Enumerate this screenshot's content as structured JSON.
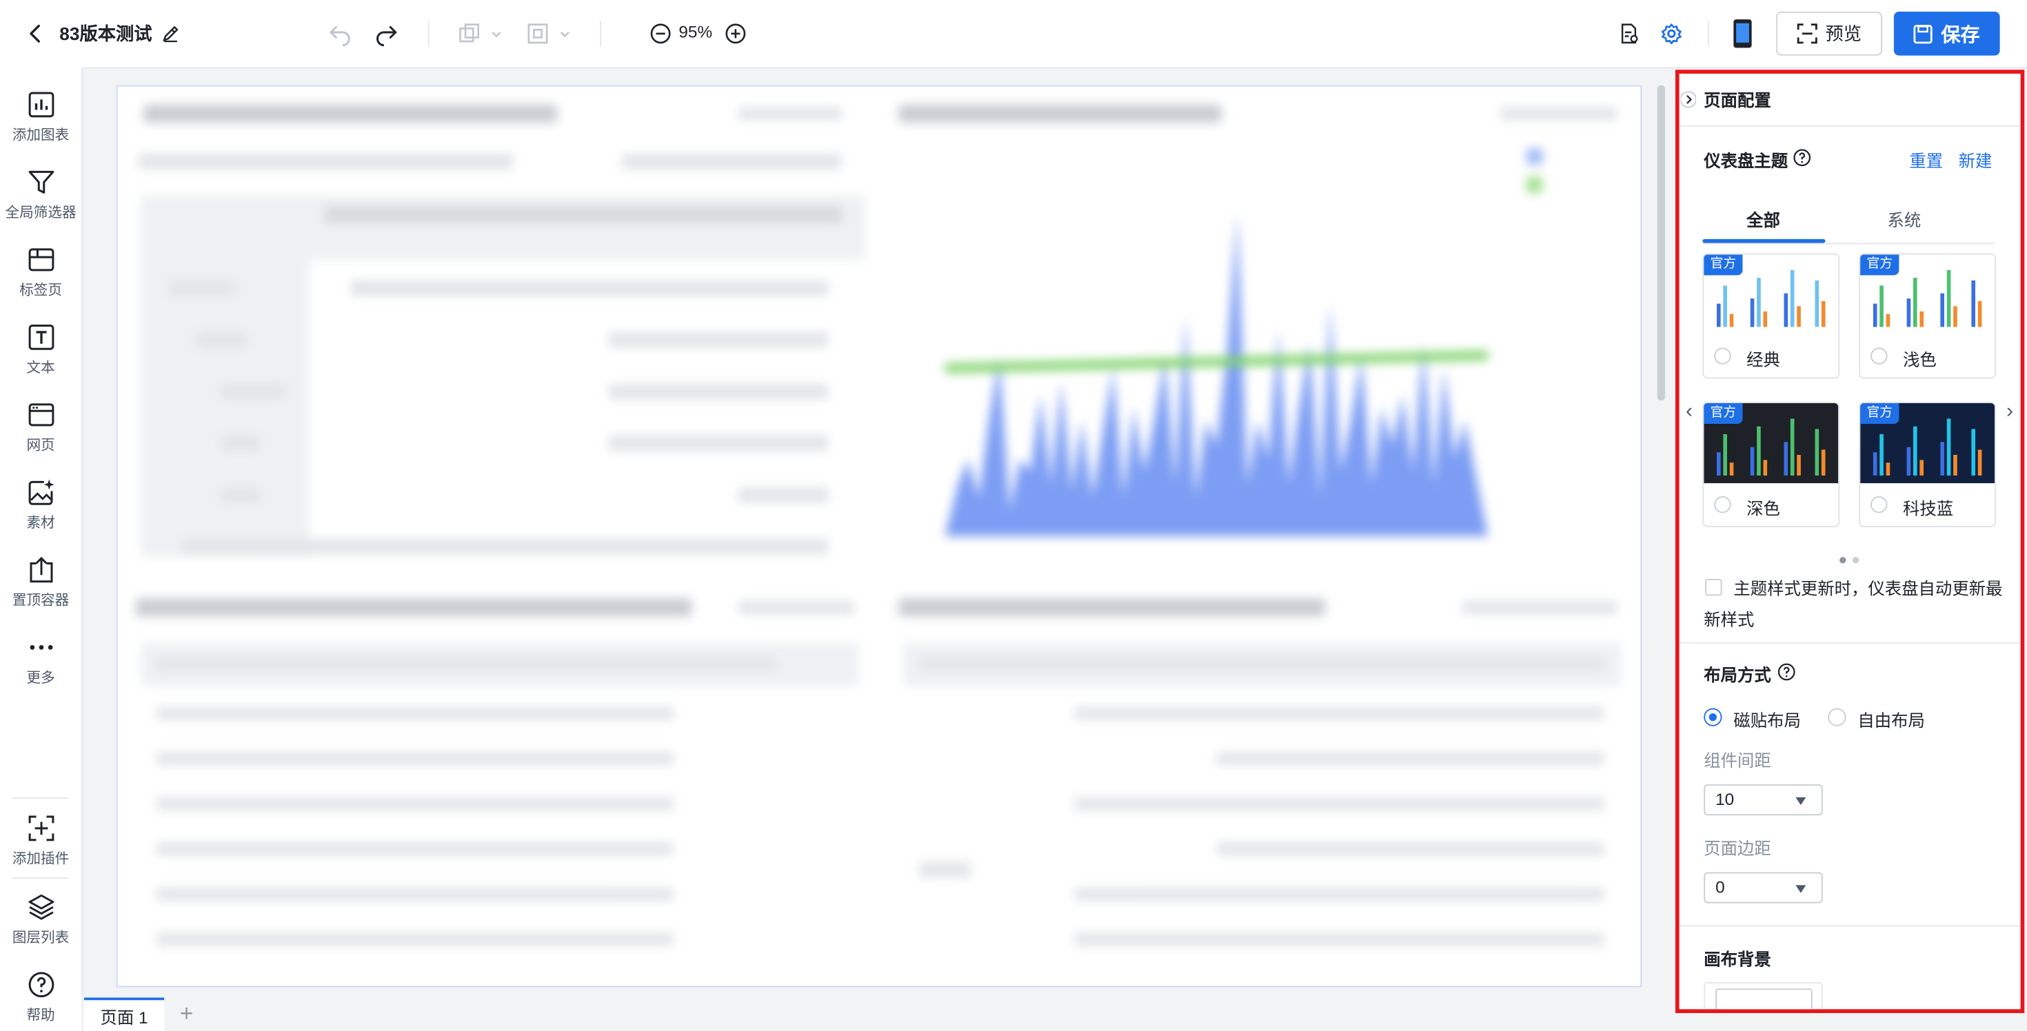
{
  "header": {
    "title": "83版本测试",
    "zoom": "95%",
    "preview_label": "预览",
    "save_label": "保存"
  },
  "leftbar": {
    "items": [
      {
        "label": "添加图表",
        "icon": "bar-chart-icon"
      },
      {
        "label": "全局筛选器",
        "icon": "filter-icon"
      },
      {
        "label": "标签页",
        "icon": "tab-page-icon"
      },
      {
        "label": "文本",
        "icon": "text-icon"
      },
      {
        "label": "网页",
        "icon": "webpage-icon"
      },
      {
        "label": "素材",
        "icon": "image-material-icon"
      },
      {
        "label": "置顶容器",
        "icon": "pin-top-container-icon"
      },
      {
        "label": "更多",
        "icon": "more-icon"
      },
      {
        "label": "添加插件",
        "icon": "add-plugin-icon"
      },
      {
        "label": "图层列表",
        "icon": "layers-icon"
      },
      {
        "label": "帮助",
        "icon": "help-icon"
      }
    ]
  },
  "pages": {
    "tabs": [
      "页面 1"
    ],
    "add": "+"
  },
  "panel": {
    "title": "页面配置",
    "theme_section": "仪表盘主题",
    "reset": "重置",
    "new": "新建",
    "tabs": [
      "全部",
      "系统"
    ],
    "themes": [
      {
        "badge": "官方",
        "name": "经典"
      },
      {
        "badge": "官方",
        "name": "浅色"
      },
      {
        "badge": "官方",
        "name": "深色"
      },
      {
        "badge": "官方",
        "name": "科技蓝"
      }
    ],
    "auto_update_line1": "主题样式更新时，仪表盘自动更新最",
    "auto_update_line2": "新样式",
    "layout_section": "布局方式",
    "layout_options": [
      "磁贴布局",
      "自由布局"
    ],
    "spacing_label": "组件间距",
    "spacing_value": "10",
    "margin_label": "页面边距",
    "margin_value": "0",
    "background_section": "画布背景"
  },
  "colors": {
    "primary": "#1f6fe8",
    "highlight_border": "#e8151b"
  }
}
